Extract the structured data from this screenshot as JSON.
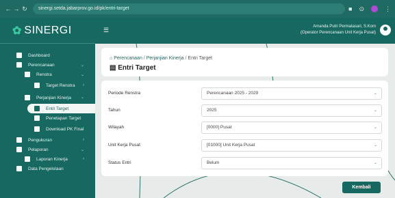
{
  "browser": {
    "url": "sinergi.setda.jabarprov.go.id/pk/entri-target",
    "back_icon": "arrow-left",
    "forward_icon": "arrow-right",
    "reload_icon": "reload"
  },
  "app": {
    "name": "SINERGI"
  },
  "sidebar": {
    "items": [
      {
        "label": "Dashboard"
      },
      {
        "label": "Perencanaan"
      },
      {
        "label": "Renstra"
      },
      {
        "label": "Target Renstra"
      },
      {
        "label": "Perjanjian Kinerja"
      },
      {
        "label": "Entri Target"
      },
      {
        "label": "Penetapan Target"
      },
      {
        "label": "Download PK Final"
      },
      {
        "label": "Pengukuran"
      },
      {
        "label": "Pelaporan"
      },
      {
        "label": "Laporan Kinerja"
      },
      {
        "label": "Data Pengelolaan"
      }
    ]
  },
  "header": {
    "user_name": "Amanda Putri Permatasari, S.Kom",
    "user_role": "(Operator Perencanaan Unit Kerja Pusat)"
  },
  "breadcrumb": {
    "root": "Perencanaan",
    "mid": "Perjanjian Kinerja",
    "current": "Entri Target"
  },
  "page": {
    "title": "Entri Target"
  },
  "form": {
    "fields": [
      {
        "label": "Periode Renstra",
        "value": "Perencanaan 2025 - 2029"
      },
      {
        "label": "Tahun",
        "value": "2025"
      },
      {
        "label": "Wilayah",
        "value": "[0000] Pusat"
      },
      {
        "label": "Unit Kerja Pusat",
        "value": "[01000] Unit Kerja Pusat"
      },
      {
        "label": "Status Entri",
        "value": "Belum"
      }
    ]
  },
  "buttons": {
    "back_label": "Kembali"
  }
}
